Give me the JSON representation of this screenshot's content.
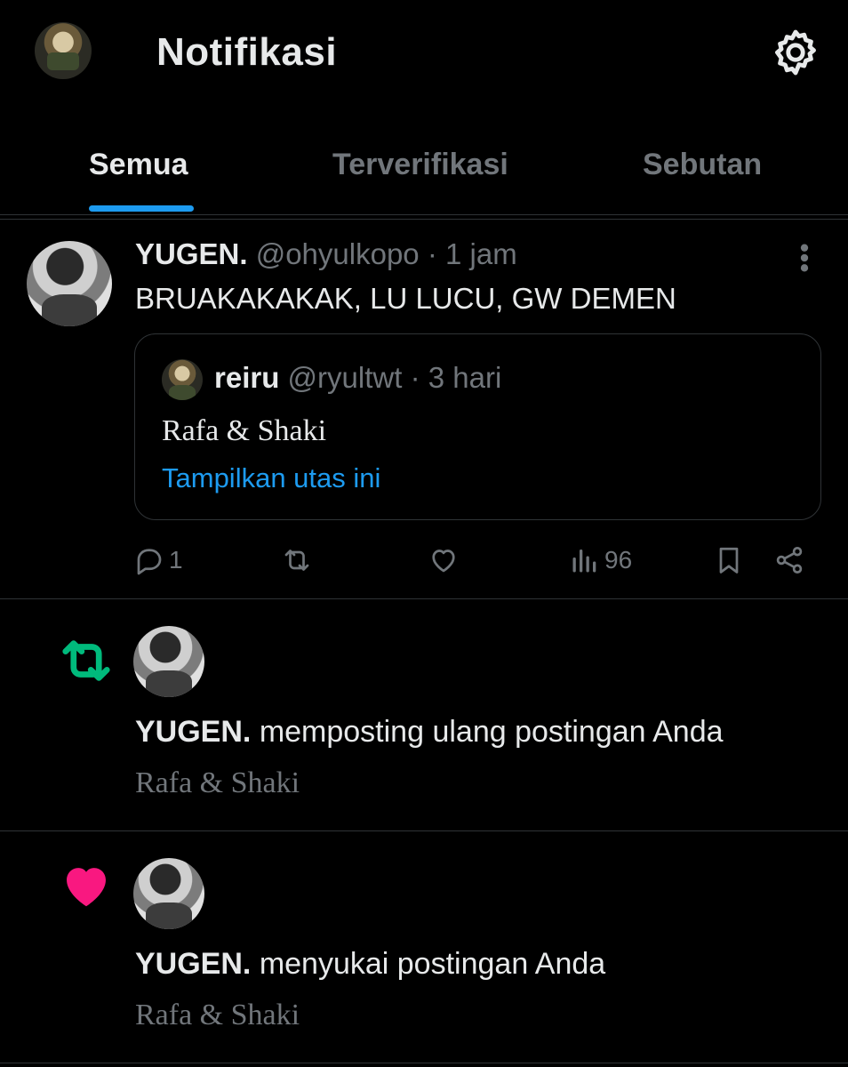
{
  "header": {
    "title": "Notifikasi"
  },
  "tabs": [
    {
      "label": "Semua",
      "active": true
    },
    {
      "label": "Terverifikasi",
      "active": false
    },
    {
      "label": "Sebutan",
      "active": false
    }
  ],
  "post": {
    "name": "YUGEN.",
    "handle": "@ohyulkopo",
    "time": "1 jam",
    "text": "BRUAKAKAKAK, LU LUCU, GW DEMEN",
    "quote": {
      "name": "reiru",
      "handle": "@ryultwt",
      "time": "3 hari",
      "text": "Rafa & Shaki",
      "link": "Tampilkan utas ini"
    },
    "actions": {
      "replies": "1",
      "views": "96"
    }
  },
  "notifications": [
    {
      "type": "repost",
      "icon": "repost-icon",
      "name": "YUGEN.",
      "action": "memposting ulang postingan Anda",
      "snippet": "Rafa & Shaki"
    },
    {
      "type": "like",
      "icon": "heart-icon",
      "name": "YUGEN.",
      "action": "menyukai postingan Anda",
      "snippet": "Rafa & Shaki"
    }
  ],
  "colors": {
    "background": "#000000",
    "accent": "#1d9bf0",
    "repost": "#00ba7c",
    "like": "#f91880",
    "muted": "#71767b"
  }
}
